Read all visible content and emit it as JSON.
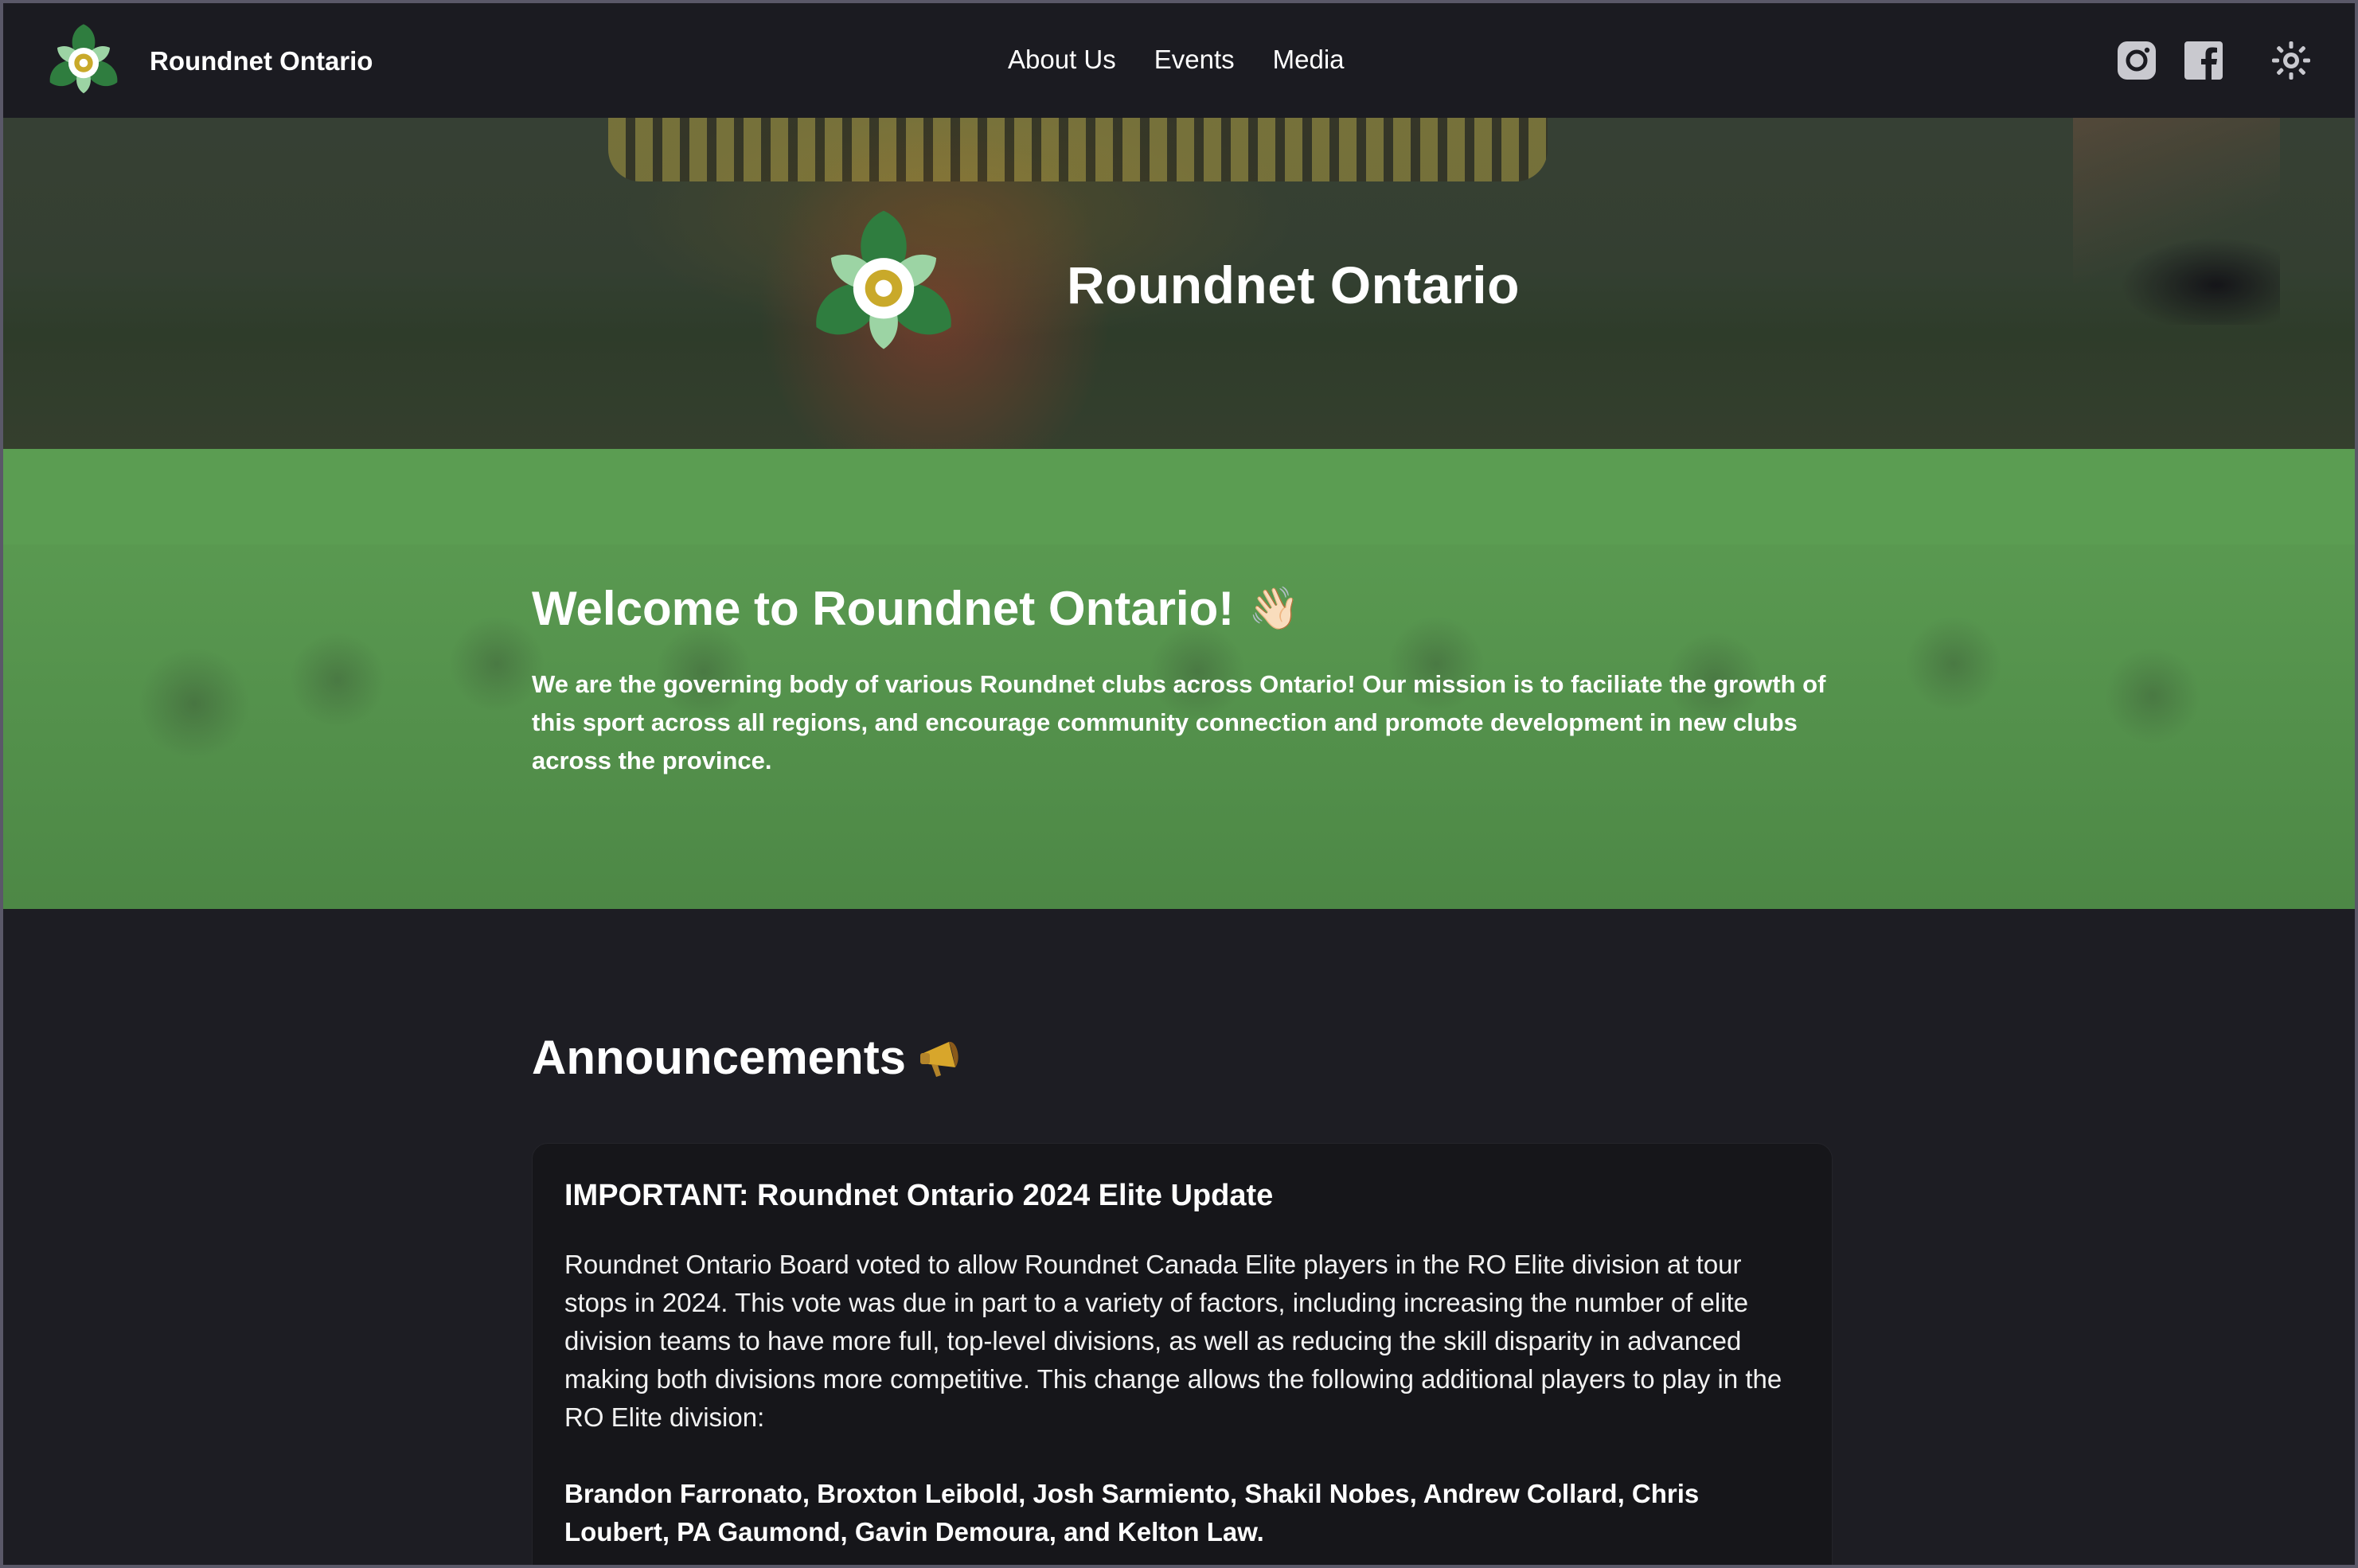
{
  "nav": {
    "brand": "Roundnet Ontario",
    "links": [
      "About Us",
      "Events",
      "Media"
    ],
    "icons": [
      "instagram-icon",
      "facebook-icon",
      "theme-toggle-icon"
    ]
  },
  "hero": {
    "title": "Roundnet Ontario"
  },
  "welcome": {
    "title": "Welcome to Roundnet Ontario!",
    "emoji": "👋🏻",
    "text": "We are the governing body of various Roundnet clubs across Ontario! Our mission is to faciliate the growth of this sport across all regions, and encourage community connection and promote development in new clubs across the province."
  },
  "announcements": {
    "title": "Announcements",
    "emoji_icon": "megaphone-icon",
    "items": [
      {
        "title": "IMPORTANT: Roundnet Ontario 2024 Elite Update",
        "body": "Roundnet Ontario Board voted to allow Roundnet Canada Elite players in the RO Elite division at tour stops in 2024. This vote was due in part to a variety of factors, including increasing the number of elite division teams to have more full, top-level divisions, as well as reducing the skill disparity in advanced making both divisions more competitive. This change allows the following additional players to play in the RO Elite division:",
        "names": "Brandon Farronato, Broxton Leibold, Josh Sarmiento, Shakil Nobes, Andrew Collard, Chris Loubert, PA Gaumond, Gavin Demoura, and Kelton Law."
      }
    ]
  },
  "colors": {
    "nav_bg": "#1b1b21",
    "page_bg": "#1d1d23",
    "welcome_green": "#5b9d52",
    "card_bg": "#16161a",
    "logo_green": "#2f7d3f",
    "logo_gold": "#c9a92a"
  }
}
